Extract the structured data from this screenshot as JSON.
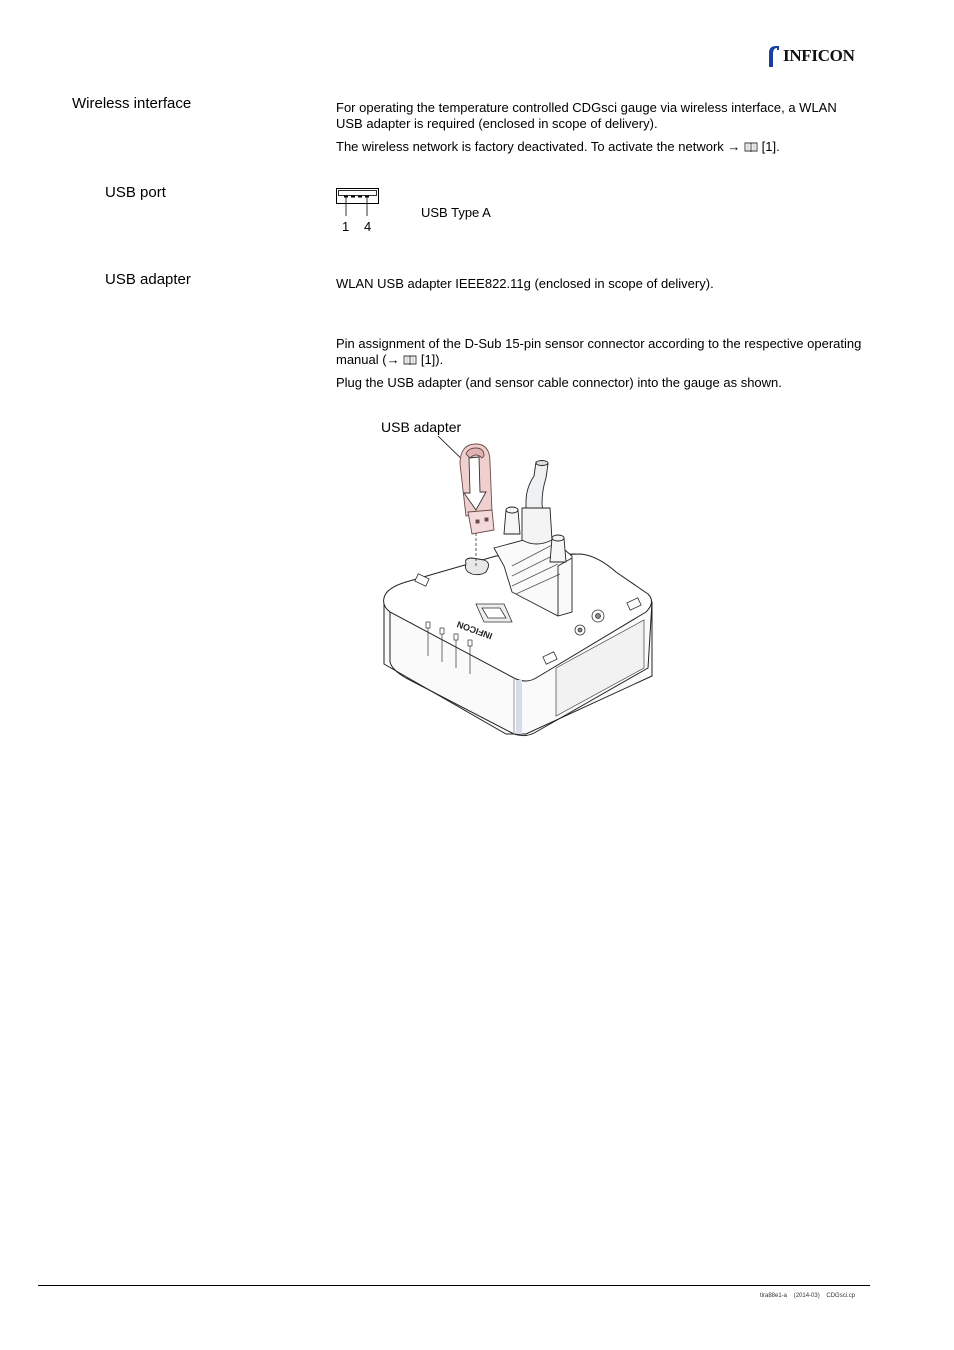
{
  "header": {
    "brand": "INFICON",
    "brand_color": "#1a3fa0"
  },
  "sections": [
    {
      "heading": "Wireless interface",
      "paragraphs": [
        "For operating the temperature controlled CDGsci gauge via wireless interface, a WLAN USB adapter is required (enclosed in scope of delivery).",
        "The wireless network is factory deactivated. To activate the network"
      ],
      "reference": "[1]."
    },
    {
      "heading": "USB port",
      "connector_type": "USB Type A",
      "pin_labels": [
        "1",
        "4"
      ]
    },
    {
      "heading": "USB adapter",
      "description": "WLAN USB adapter IEEE822.11g (enclosed in scope of delivery).",
      "pin_note_prefix": "Pin assignment of the D-Sub 15-pin sensor connector according to the respective operating manual (",
      "pin_note_ref": "[1]).",
      "plug_note": "Plug the USB adapter (and sensor cable connector) into the gauge as shown."
    }
  ],
  "figure": {
    "callout": "USB adapter",
    "adapter_color": "#f0cfcf",
    "device_brand": "INFICON"
  },
  "symbols": {
    "arrow": "→"
  },
  "footer": {
    "doc_id": "tira88e1-a",
    "date": "(2014-03)",
    "file": "CDGsci.cp"
  }
}
